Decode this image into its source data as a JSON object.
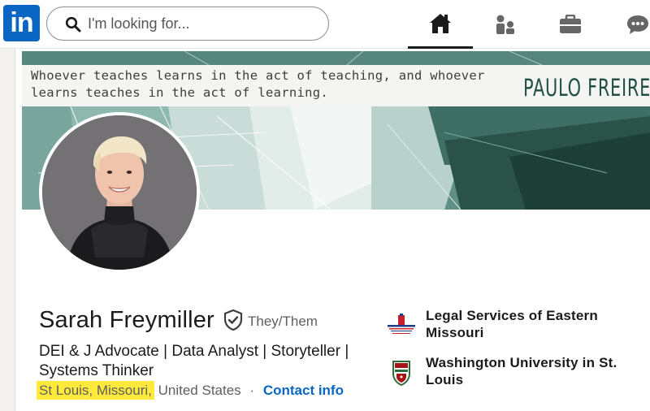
{
  "nav": {
    "logo_text": "in",
    "search_placeholder": "I'm looking for...",
    "items": [
      {
        "icon": "home-icon",
        "active": true
      },
      {
        "icon": "my-network-icon",
        "active": false
      },
      {
        "icon": "jobs-icon",
        "active": false
      },
      {
        "icon": "messaging-icon",
        "active": false
      }
    ]
  },
  "banner": {
    "quote": "Whoever teaches learns in the act of teaching, and whoever learns teaches in the act of learning.",
    "author": "PAULO FREIRE"
  },
  "profile": {
    "name": "Sarah Freymiller",
    "pronouns": "They/Them",
    "headline": "DEI & J Advocate | Data Analyst | Storyteller | Systems Thinker",
    "location_city": "St Louis, Missouri,",
    "location_country": "United States",
    "separator": "·",
    "contact_label": "Contact info"
  },
  "organizations": [
    {
      "name": "Legal Services of Eastern Missouri",
      "icon": "legal-services-logo"
    },
    {
      "name": "Washington University in St. Louis",
      "icon": "washington-university-logo"
    }
  ],
  "colors": {
    "brand": "#0a66c2",
    "highlight": "#ffe93d",
    "banner": "#4b7d72"
  }
}
